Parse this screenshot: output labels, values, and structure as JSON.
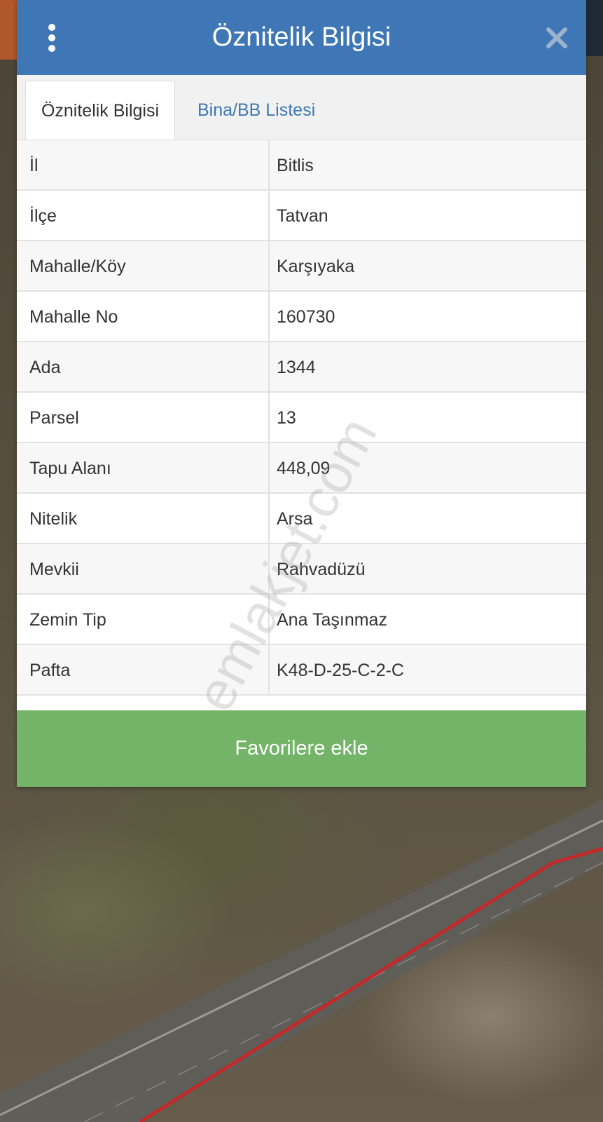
{
  "header": {
    "title": "Öznitelik Bilgisi",
    "menu_icon": "more-vertical-icon",
    "close_icon": "close-icon"
  },
  "tabs": [
    {
      "label": "Öznitelik Bilgisi",
      "active": true
    },
    {
      "label": "Bina/BB Listesi",
      "active": false
    }
  ],
  "attributes": [
    {
      "key": "İl",
      "value": "Bitlis"
    },
    {
      "key": "İlçe",
      "value": "Tatvan"
    },
    {
      "key": "Mahalle/Köy",
      "value": "Karşıyaka"
    },
    {
      "key": "Mahalle No",
      "value": "160730"
    },
    {
      "key": "Ada",
      "value": "1344"
    },
    {
      "key": "Parsel",
      "value": "13"
    },
    {
      "key": "Tapu Alanı",
      "value": "448,09"
    },
    {
      "key": "Nitelik",
      "value": "Arsa"
    },
    {
      "key": "Mevkii",
      "value": "Rahvadüzü"
    },
    {
      "key": "Zemin Tip",
      "value": "Ana Taşınmaz"
    },
    {
      "key": "Pafta",
      "value": "K48-D-25-C-2-C"
    }
  ],
  "actions": {
    "favorite_label": "Favorilere ekle"
  },
  "watermark": "emlakjet.com",
  "colors": {
    "header": "#3f77b6",
    "button": "#74b468",
    "tab_link": "#3f77b6"
  }
}
